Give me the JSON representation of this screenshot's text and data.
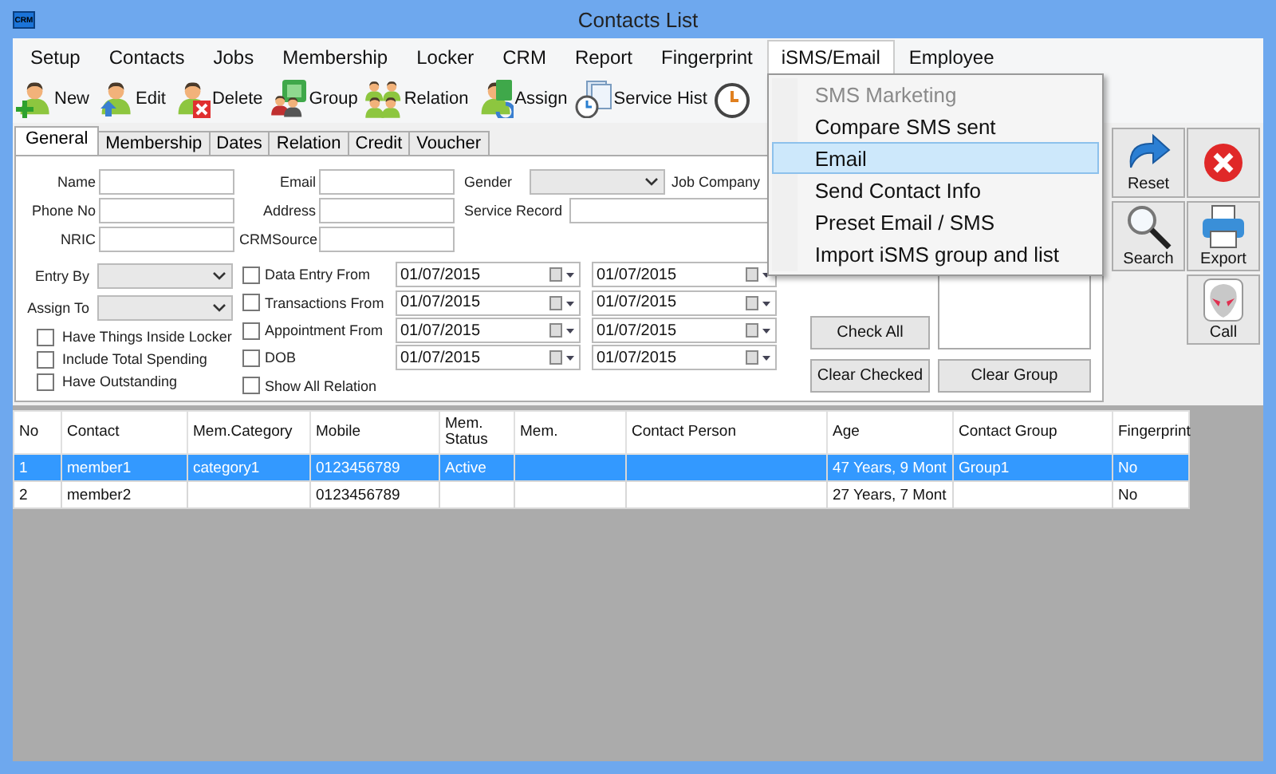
{
  "window": {
    "title": "Contacts List",
    "app_icon_text": "CRM"
  },
  "menu": [
    {
      "label": "Setup",
      "selected": false
    },
    {
      "label": "Contacts",
      "selected": false
    },
    {
      "label": "Jobs",
      "selected": false
    },
    {
      "label": "Membership",
      "selected": false
    },
    {
      "label": "Locker",
      "selected": false
    },
    {
      "label": "CRM",
      "selected": false
    },
    {
      "label": "Report",
      "selected": false
    },
    {
      "label": "Fingerprint",
      "selected": false
    },
    {
      "label": "iSMS/Email",
      "selected": true,
      "items": [
        {
          "label": "SMS Marketing",
          "disabled": true,
          "selected": false
        },
        {
          "label": "Compare SMS sent",
          "disabled": false,
          "selected": false
        },
        {
          "label": "Email",
          "disabled": false,
          "selected": true
        },
        {
          "label": "Send Contact Info",
          "disabled": false,
          "selected": false
        },
        {
          "label": "Preset Email / SMS",
          "disabled": false,
          "selected": false
        },
        {
          "label": "Import iSMS group and list",
          "disabled": false,
          "selected": false
        }
      ]
    },
    {
      "label": "Employee",
      "selected": false
    }
  ],
  "toolbar": [
    {
      "label": "New",
      "kind": "new"
    },
    {
      "label": "Edit",
      "kind": "edit"
    },
    {
      "label": "Delete",
      "kind": "delete"
    },
    {
      "label": "Group",
      "kind": "group"
    },
    {
      "label": "Relation",
      "kind": "relation"
    },
    {
      "label": "Assign",
      "kind": "assign"
    },
    {
      "label": "Service Hist",
      "kind": "history"
    },
    {
      "kind": "clock"
    }
  ],
  "tabs": [
    {
      "label": "General",
      "selected": true
    },
    {
      "label": "Membership",
      "selected": false
    },
    {
      "label": "Dates",
      "selected": false
    },
    {
      "label": "Relation",
      "selected": false
    },
    {
      "label": "Credit",
      "selected": false
    },
    {
      "label": "Voucher",
      "selected": false
    }
  ],
  "form": {
    "column_1": [
      {
        "label": "Name"
      },
      {
        "label": "Phone No"
      },
      {
        "label": "NRIC"
      }
    ],
    "column_2": [
      {
        "label": "Email"
      },
      {
        "label": "Address"
      },
      {
        "label": "CRMSource"
      }
    ],
    "gender": {
      "label": "Gender"
    },
    "job_company": {
      "label": "Job Company"
    },
    "service_record": {
      "label": "Service Record"
    },
    "dropdowns": [
      {
        "label": "Entry By"
      },
      {
        "label": "Assign To"
      }
    ],
    "options": [
      {
        "label": "Have Things Inside Locker",
        "checked": false
      },
      {
        "label": "Include Total Spending",
        "checked": false
      },
      {
        "label": "Have Outstanding",
        "checked": false
      }
    ],
    "date_filters": [
      {
        "label": "Data Entry From",
        "checked": false,
        "from": "01/07/2015",
        "to": "01/07/2015"
      },
      {
        "label": "Transactions From",
        "checked": false,
        "from": "01/07/2015",
        "to": "01/07/2015"
      },
      {
        "label": "Appointment From",
        "checked": false,
        "from": "01/07/2015",
        "to": "01/07/2015"
      },
      {
        "label": "DOB",
        "checked": false,
        "from": "01/07/2015",
        "to": "01/07/2015"
      }
    ],
    "show_all_relation": {
      "label": "Show All Relation",
      "checked": false
    },
    "check_all": "Check All",
    "clear_checked": "Clear Checked",
    "clear_group": "Clear Group"
  },
  "side_buttons": [
    {
      "label": "Reset",
      "kind": "reset"
    },
    {
      "kind": "close"
    },
    {
      "label": "Search",
      "kind": "search"
    },
    {
      "label": "Export",
      "kind": "export"
    },
    {
      "kind": "empty"
    },
    {
      "label": "Call",
      "kind": "call"
    }
  ],
  "table": {
    "columns": [
      "No",
      "Contact",
      "Mem.Category",
      "Mobile",
      "Mem. Status",
      "Mem.",
      "Contact Person",
      "Age",
      "Contact Group",
      "Fingerprint"
    ],
    "rows": [
      {
        "selected": true,
        "no": "1",
        "contact": "member1",
        "mem_category": "category1",
        "mobile": "0123456789",
        "mem_status": "Active",
        "age": "47 Years, 9 Mont",
        "contact_group": "Group1",
        "fingerprint": "No"
      },
      {
        "selected": false,
        "no": "2",
        "contact": "member2",
        "mobile": "0123456789",
        "age": "27 Years, 7 Mont",
        "fingerprint": "No"
      }
    ]
  }
}
